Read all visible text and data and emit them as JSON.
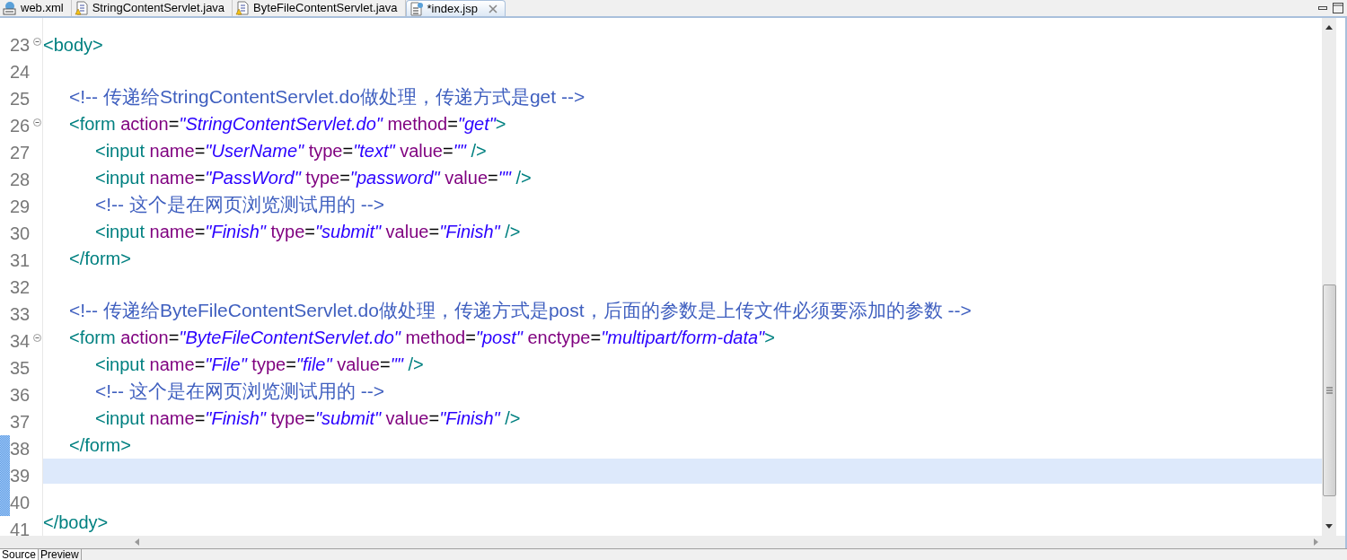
{
  "editor_tabs": [
    {
      "label": "web.xml",
      "kind": "xml",
      "selected": false,
      "closable": false
    },
    {
      "label": "StringContentServlet.java",
      "kind": "java",
      "selected": false,
      "closable": false
    },
    {
      "label": "ByteFileContentServlet.java",
      "kind": "java",
      "selected": false,
      "closable": false
    },
    {
      "label": "*index.jsp",
      "kind": "jsp",
      "selected": true,
      "closable": true
    }
  ],
  "lines": [
    {
      "number": "23",
      "foldable": true,
      "current": false,
      "changed": false,
      "tokens": [
        {
          "kind": "tag",
          "text": "<body>"
        }
      ]
    },
    {
      "number": "24",
      "foldable": false,
      "current": false,
      "changed": false
    },
    {
      "number": "25",
      "foldable": false,
      "current": false,
      "changed": false,
      "tokens": [
        {
          "kind": "comment",
          "text": "\t<!-- 传递给StringContentServlet.do做处理，传递方式是get -->"
        }
      ]
    },
    {
      "number": "26",
      "foldable": true,
      "current": false,
      "changed": false,
      "tokens": [
        {
          "kind": "tag",
          "text": "\t<form"
        },
        {
          "kind": "attr",
          "text": " action"
        },
        {
          "kind": "eq",
          "text": "="
        },
        {
          "kind": "value",
          "text": "\"StringContentServlet.do\""
        },
        {
          "kind": "attr",
          "text": " method"
        },
        {
          "kind": "eq",
          "text": "="
        },
        {
          "kind": "value",
          "text": "\"get\""
        },
        {
          "kind": "tag",
          "text": ">"
        }
      ]
    },
    {
      "number": "27",
      "foldable": false,
      "current": false,
      "changed": false,
      "tokens": [
        {
          "kind": "tag",
          "text": "\t\t<input"
        },
        {
          "kind": "attr",
          "text": " name"
        },
        {
          "kind": "eq",
          "text": "="
        },
        {
          "kind": "value",
          "text": "\"UserName\""
        },
        {
          "kind": "attr",
          "text": " type"
        },
        {
          "kind": "eq",
          "text": "="
        },
        {
          "kind": "value",
          "text": "\"text\""
        },
        {
          "kind": "attr",
          "text": " value"
        },
        {
          "kind": "eq",
          "text": "="
        },
        {
          "kind": "value",
          "text": "\"\""
        },
        {
          "kind": "tag",
          "text": " />"
        }
      ]
    },
    {
      "number": "28",
      "foldable": false,
      "current": false,
      "changed": false,
      "tokens": [
        {
          "kind": "tag",
          "text": "\t\t<input"
        },
        {
          "kind": "attr",
          "text": " name"
        },
        {
          "kind": "eq",
          "text": "="
        },
        {
          "kind": "value",
          "text": "\"PassWord\""
        },
        {
          "kind": "attr",
          "text": " type"
        },
        {
          "kind": "eq",
          "text": "="
        },
        {
          "kind": "value",
          "text": "\"password\""
        },
        {
          "kind": "attr",
          "text": " value"
        },
        {
          "kind": "eq",
          "text": "="
        },
        {
          "kind": "value",
          "text": "\"\""
        },
        {
          "kind": "tag",
          "text": " />"
        }
      ]
    },
    {
      "number": "29",
      "foldable": false,
      "current": false,
      "changed": false,
      "tokens": [
        {
          "kind": "comment",
          "text": "\t\t<!-- 这个是在网页浏览测试用的 -->"
        }
      ]
    },
    {
      "number": "30",
      "foldable": false,
      "current": false,
      "changed": false,
      "tokens": [
        {
          "kind": "tag",
          "text": "\t\t<input"
        },
        {
          "kind": "attr",
          "text": " name"
        },
        {
          "kind": "eq",
          "text": "="
        },
        {
          "kind": "value",
          "text": "\"Finish\""
        },
        {
          "kind": "attr",
          "text": " type"
        },
        {
          "kind": "eq",
          "text": "="
        },
        {
          "kind": "value",
          "text": "\"submit\""
        },
        {
          "kind": "attr",
          "text": " value"
        },
        {
          "kind": "eq",
          "text": "="
        },
        {
          "kind": "value",
          "text": "\"Finish\""
        },
        {
          "kind": "tag",
          "text": " />"
        }
      ]
    },
    {
      "number": "31",
      "foldable": false,
      "current": false,
      "changed": false,
      "tokens": [
        {
          "kind": "tag",
          "text": "\t</form>"
        }
      ]
    },
    {
      "number": "32",
      "foldable": false,
      "current": false,
      "changed": false
    },
    {
      "number": "33",
      "foldable": false,
      "current": false,
      "changed": false,
      "tokens": [
        {
          "kind": "comment",
          "text": "\t<!-- 传递给ByteFileContentServlet.do做处理，传递方式是post，后面的参数是上传文件必须要添加的参数 -->"
        }
      ]
    },
    {
      "number": "34",
      "foldable": true,
      "current": false,
      "changed": false,
      "tokens": [
        {
          "kind": "tag",
          "text": "\t<form"
        },
        {
          "kind": "attr",
          "text": " action"
        },
        {
          "kind": "eq",
          "text": "="
        },
        {
          "kind": "value",
          "text": "\"ByteFileContentServlet.do\""
        },
        {
          "kind": "attr",
          "text": " method"
        },
        {
          "kind": "eq",
          "text": "="
        },
        {
          "kind": "value",
          "text": "\"post\""
        },
        {
          "kind": "attr",
          "text": " enctype"
        },
        {
          "kind": "eq",
          "text": "="
        },
        {
          "kind": "value",
          "text": "\"multipart/form-data\""
        },
        {
          "kind": "tag",
          "text": ">"
        }
      ]
    },
    {
      "number": "35",
      "foldable": false,
      "current": false,
      "changed": false,
      "tokens": [
        {
          "kind": "tag",
          "text": "\t\t<input"
        },
        {
          "kind": "attr",
          "text": " name"
        },
        {
          "kind": "eq",
          "text": "="
        },
        {
          "kind": "value",
          "text": "\"File\""
        },
        {
          "kind": "attr",
          "text": " type"
        },
        {
          "kind": "eq",
          "text": "="
        },
        {
          "kind": "value",
          "text": "\"file\""
        },
        {
          "kind": "attr",
          "text": " value"
        },
        {
          "kind": "eq",
          "text": "="
        },
        {
          "kind": "value",
          "text": "\"\""
        },
        {
          "kind": "tag",
          "text": " />"
        }
      ]
    },
    {
      "number": "36",
      "foldable": false,
      "current": false,
      "changed": false,
      "tokens": [
        {
          "kind": "comment",
          "text": "\t\t<!-- 这个是在网页浏览测试用的 -->"
        }
      ]
    },
    {
      "number": "37",
      "foldable": false,
      "current": false,
      "changed": false,
      "tokens": [
        {
          "kind": "tag",
          "text": "\t\t<input"
        },
        {
          "kind": "attr",
          "text": " name"
        },
        {
          "kind": "eq",
          "text": "="
        },
        {
          "kind": "value",
          "text": "\"Finish\""
        },
        {
          "kind": "attr",
          "text": " type"
        },
        {
          "kind": "eq",
          "text": "="
        },
        {
          "kind": "value",
          "text": "\"submit\""
        },
        {
          "kind": "attr",
          "text": " value"
        },
        {
          "kind": "eq",
          "text": "="
        },
        {
          "kind": "value",
          "text": "\"Finish\""
        },
        {
          "kind": "tag",
          "text": " />"
        }
      ]
    },
    {
      "number": "38",
      "foldable": false,
      "current": false,
      "changed": true,
      "tokens": [
        {
          "kind": "tag",
          "text": "\t</form>"
        }
      ]
    },
    {
      "number": "39",
      "foldable": false,
      "current": true,
      "changed": true
    },
    {
      "number": "40",
      "foldable": false,
      "current": false,
      "changed": true
    },
    {
      "number": "41",
      "foldable": false,
      "current": false,
      "changed": false,
      "tokens": [
        {
          "kind": "tag",
          "text": "</body>"
        }
      ]
    }
  ],
  "bottom_tabs": [
    {
      "label": "Source",
      "selected": true
    },
    {
      "label": "Preview",
      "selected": false
    }
  ]
}
